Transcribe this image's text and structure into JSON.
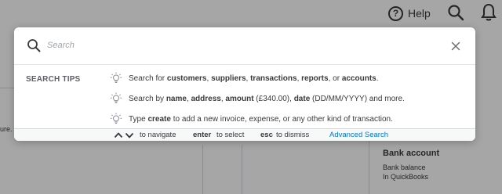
{
  "header": {
    "help_label": "Help",
    "help_icon_glyph": "?"
  },
  "background": {
    "left_fragment": "ure.",
    "bank_account": {
      "title": "Bank account",
      "line1": "Bank balance",
      "line2": "In QuickBooks"
    }
  },
  "search": {
    "placeholder": "Search",
    "value": ""
  },
  "tips": {
    "label": "SEARCH TIPS",
    "items": [
      {
        "icon": "lightbulb-icon",
        "segments": [
          {
            "text": "Search for ",
            "bold": false
          },
          {
            "text": "customers",
            "bold": true
          },
          {
            "text": ", ",
            "bold": false
          },
          {
            "text": "suppliers",
            "bold": true
          },
          {
            "text": ", ",
            "bold": false
          },
          {
            "text": "transactions",
            "bold": true
          },
          {
            "text": ", ",
            "bold": false
          },
          {
            "text": "reports",
            "bold": true
          },
          {
            "text": ", or ",
            "bold": false
          },
          {
            "text": "accounts",
            "bold": true
          },
          {
            "text": ".",
            "bold": false
          }
        ]
      },
      {
        "icon": "lightbulb-icon",
        "segments": [
          {
            "text": "Search by ",
            "bold": false
          },
          {
            "text": "name",
            "bold": true
          },
          {
            "text": ", ",
            "bold": false
          },
          {
            "text": "address",
            "bold": true
          },
          {
            "text": ", ",
            "bold": false
          },
          {
            "text": "amount",
            "bold": true
          },
          {
            "text": " (£340.00), ",
            "bold": false
          },
          {
            "text": "date",
            "bold": true
          },
          {
            "text": " (DD/MM/YYYY) and more.",
            "bold": false
          }
        ]
      },
      {
        "icon": "lightbulb-icon",
        "segments": [
          {
            "text": "Type ",
            "bold": false
          },
          {
            "text": "create",
            "bold": true
          },
          {
            "text": " to add a new invoice, expense, or any other kind of transaction.",
            "bold": false
          }
        ]
      }
    ]
  },
  "footer": {
    "navigate_text": "to navigate",
    "enter_key": "enter",
    "select_text": "to select",
    "esc_key": "esc",
    "dismiss_text": "to dismiss",
    "advanced_search_label": "Advanced Search"
  },
  "colors": {
    "link": "#0077c5",
    "text": "#393a3d",
    "muted": "#5d6067",
    "overlay": "rgba(0,0,0,0.35)"
  }
}
